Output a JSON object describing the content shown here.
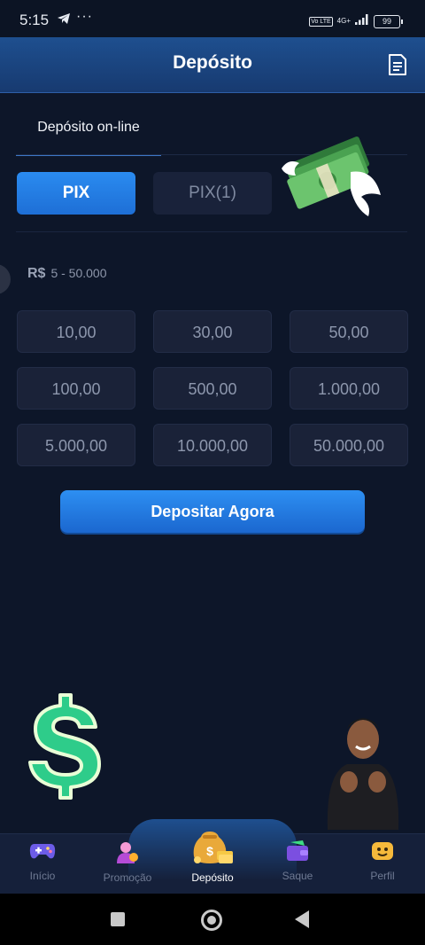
{
  "status_bar": {
    "time": "5:15",
    "more": "···",
    "volte": "Vo LTE",
    "network": "4G+",
    "battery": "99"
  },
  "header": {
    "title": "Depósito"
  },
  "tabs": {
    "active": "Depósito on-line"
  },
  "methods": [
    {
      "label": "PIX"
    },
    {
      "label": "PIX(1)"
    }
  ],
  "range": {
    "currency": "R$",
    "limits": "5 - 50.000"
  },
  "amounts": [
    "10,00",
    "30,00",
    "50,00",
    "100,00",
    "500,00",
    "1.000,00",
    "5.000,00",
    "10.000,00",
    "50.000,00"
  ],
  "cta": {
    "label": "Depositar Agora"
  },
  "bottom_nav": [
    {
      "label": "Início",
      "icon": "gamepad-icon"
    },
    {
      "label": "Promoção",
      "icon": "promotion-icon"
    },
    {
      "label": "Depósito",
      "icon": "money-bag-icon"
    },
    {
      "label": "Saque",
      "icon": "wallet-icon"
    },
    {
      "label": "Perfil",
      "icon": "profile-icon"
    }
  ],
  "colors": {
    "accent": "#2a8bf0",
    "background": "#0d1629",
    "header": "#1e4f8f"
  }
}
